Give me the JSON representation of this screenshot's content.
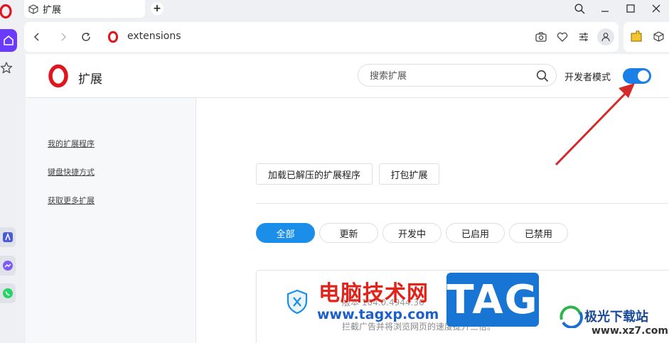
{
  "tab": {
    "title": "扩展"
  },
  "address_bar": {
    "url": "extensions"
  },
  "page": {
    "title": "扩展",
    "search": {
      "placeholder": "搜索扩展"
    },
    "developer_mode": {
      "label": "开发者模式",
      "enabled": true
    }
  },
  "sidebar": {
    "links": [
      {
        "label": "我的扩展程序"
      },
      {
        "label": "键盘快捷方式"
      },
      {
        "label": "获取更多扩展"
      }
    ]
  },
  "actions": {
    "load_unpacked": "加载已解压的扩展程序",
    "pack": "打包扩展"
  },
  "filters": [
    {
      "label": "全部",
      "active": true
    },
    {
      "label": "更新",
      "active": false
    },
    {
      "label": "开发中",
      "active": false
    },
    {
      "label": "已启用",
      "active": false
    },
    {
      "label": "已禁用",
      "active": false
    }
  ],
  "extension_card": {
    "version": "版本 104.0.4944.36",
    "description": "拦截广告并将浏览网页的速度提升三倍。"
  },
  "watermarks": {
    "site_name": "电脑技术网",
    "site_url": "www.tagxp.com",
    "tag": "TAG",
    "brand": "极光下载站",
    "brand_url": "www.xz7.com"
  },
  "colors": {
    "accent": "#1a8ee8",
    "toggle_on": "#1a7fe6",
    "opera_red": "#e0161e",
    "arrow": "#d42a2a",
    "home_button": "#6a3bff"
  },
  "icons": [
    "opera-logo-icon",
    "home-icon",
    "star-icon",
    "cube-icon",
    "search-icon",
    "minimize-icon",
    "maximize-icon",
    "close-icon",
    "back-icon",
    "forward-icon",
    "reload-icon",
    "camera-icon",
    "heart-icon",
    "sliders-icon",
    "profile-icon",
    "shield-icon"
  ]
}
